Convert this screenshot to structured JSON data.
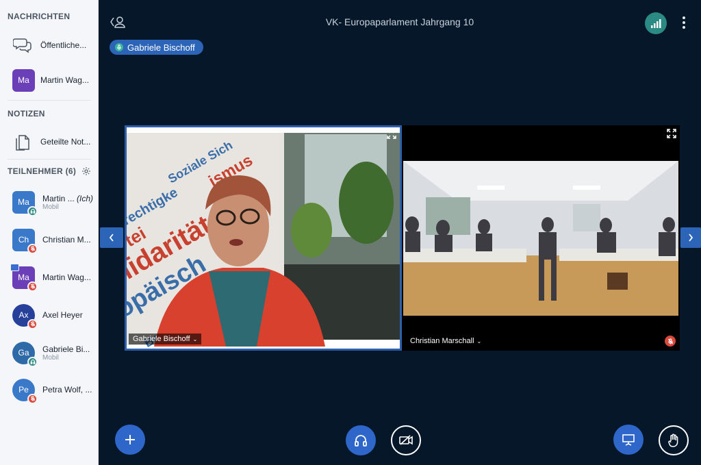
{
  "sidebar": {
    "messages_header": "NACHRICHTEN",
    "messages": [
      {
        "label": "Öffentliche..."
      },
      {
        "initials": "Ma",
        "label": "Martin Wag..."
      }
    ],
    "notes_header": "NOTIZEN",
    "notes": [
      {
        "label": "Geteilte Not..."
      }
    ],
    "participants_header": "TEILNEHMER (6)",
    "participants": [
      {
        "initials": "Ma",
        "name": "Martin ...",
        "tag": "(Ich)",
        "sub": "Mobil",
        "status": "listen"
      },
      {
        "initials": "Ch",
        "name": "Christian M...",
        "status": "muted"
      },
      {
        "initials": "Ma",
        "name": "Martin Wag...",
        "status": "muted",
        "presenter": true
      },
      {
        "initials": "Ax",
        "name": "Axel Heyer",
        "status": "muted"
      },
      {
        "initials": "Ga",
        "name": "Gabriele Bi...",
        "sub": "Mobil",
        "status": "listen"
      },
      {
        "initials": "Pe",
        "name": "Petra Wolf, ...",
        "status": "muted"
      }
    ]
  },
  "header": {
    "title": "VK- Europaparlament Jahrgang 10",
    "talking": "Gabriele Bischoff"
  },
  "videos": [
    {
      "name": "Gabriele Bischoff"
    },
    {
      "name": "Christian Marschall"
    }
  ],
  "colors": {
    "accent": "#2e67c9",
    "background": "#06172a",
    "muted": "#d94a3d",
    "listen": "#2b8a83"
  }
}
